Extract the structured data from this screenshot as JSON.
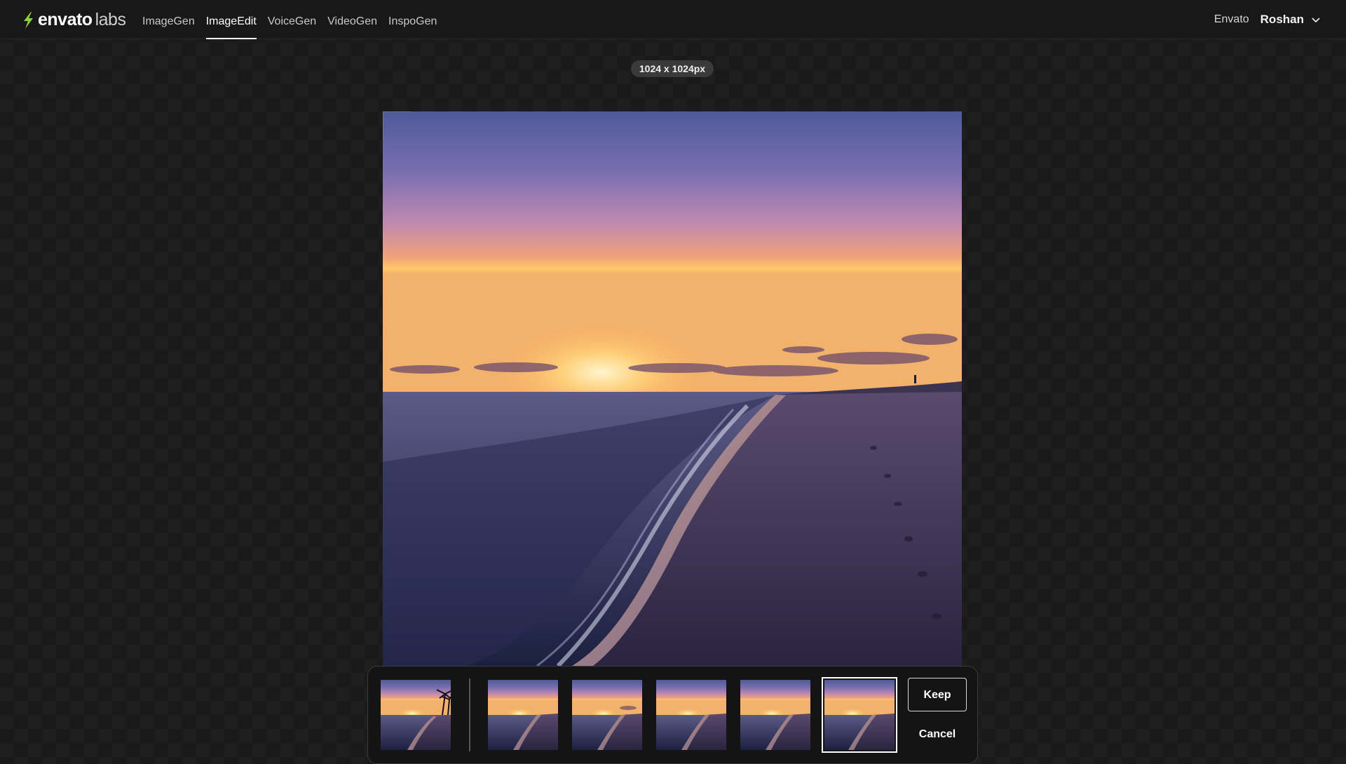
{
  "brand": {
    "name": "envato",
    "suffix": "labs",
    "accent": "#8ad43a",
    "logo_icon": "envato-leaf-icon"
  },
  "nav": {
    "items": [
      {
        "label": "ImageGen"
      },
      {
        "label": "ImageEdit",
        "active": true
      },
      {
        "label": "VoiceGen"
      },
      {
        "label": "VideoGen"
      },
      {
        "label": "InspoGen"
      }
    ],
    "right_link": "Envato",
    "user": "Roshan",
    "user_menu_icon": "chevron-down-icon"
  },
  "canvas": {
    "dimensions": "1024 x 1024px"
  },
  "variations": {
    "thumbnail_count": 6,
    "selected_index": 5
  },
  "actions": {
    "keep_label": "Keep",
    "cancel_label": "Cancel"
  }
}
